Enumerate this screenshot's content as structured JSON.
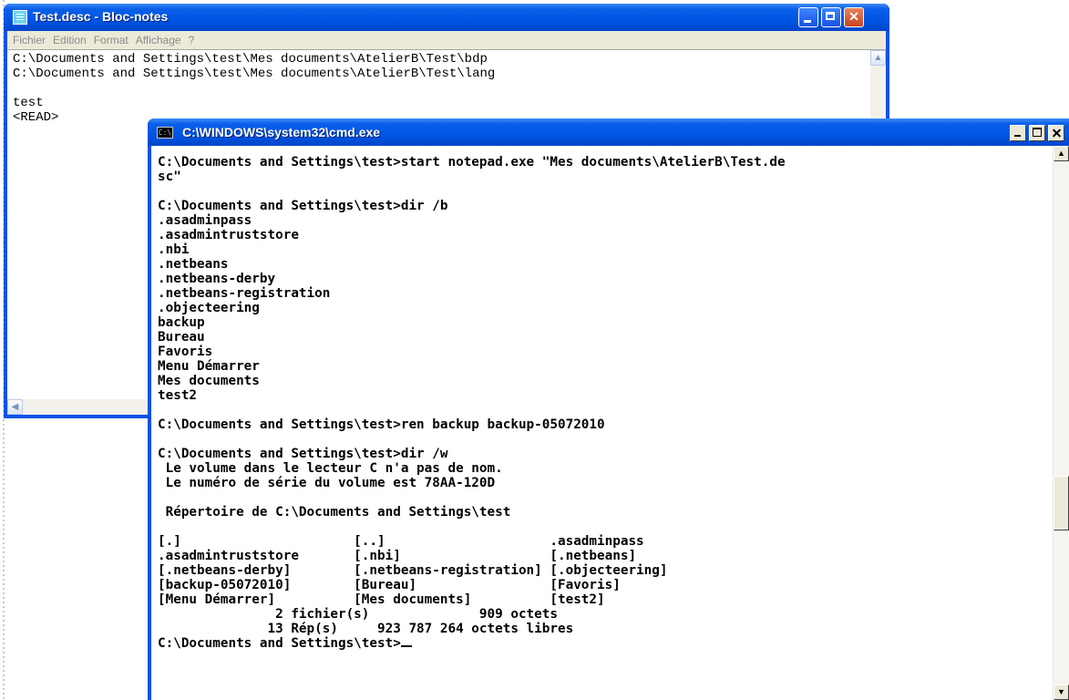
{
  "notepad": {
    "title": "Test.desc - Bloc-notes",
    "menu": [
      "Fichier",
      "Edition",
      "Format",
      "Affichage",
      "?"
    ],
    "content": "C:\\Documents and Settings\\test\\Mes documents\\AtelierB\\Test\\bdp\nC:\\Documents and Settings\\test\\Mes documents\\AtelierB\\Test\\lang\n\ntest\n<READ>",
    "scroll_up": "▲",
    "scroll_left": "◀"
  },
  "cmd": {
    "title": "C:\\WINDOWS\\system32\\cmd.exe",
    "icon_text": "C:\\",
    "content": "C:\\Documents and Settings\\test>start notepad.exe \"Mes documents\\AtelierB\\Test.de\nsc\"\n\nC:\\Documents and Settings\\test>dir /b\n.asadminpass\n.asadmintruststore\n.nbi\n.netbeans\n.netbeans-derby\n.netbeans-registration\n.objecteering\nbackup\nBureau\nFavoris\nMenu Démarrer\nMes documents\ntest2\n\nC:\\Documents and Settings\\test>ren backup backup-05072010\n\nC:\\Documents and Settings\\test>dir /w\n Le volume dans le lecteur C n'a pas de nom.\n Le numéro de série du volume est 78AA-120D\n\n Répertoire de C:\\Documents and Settings\\test\n\n[.]                      [..]                     .asadminpass\n.asadmintruststore       [.nbi]                   [.netbeans]\n[.netbeans-derby]        [.netbeans-registration] [.objecteering]\n[backup-05072010]        [Bureau]                 [Favoris]\n[Menu Démarrer]          [Mes documents]          [test2]\n               2 fichier(s)              909 octets\n              13 Rép(s)     923 787 264 octets libres\n",
    "prompt": "C:\\Documents and Settings\\test>",
    "scroll_up": "▲",
    "scroll_down": "▼"
  }
}
